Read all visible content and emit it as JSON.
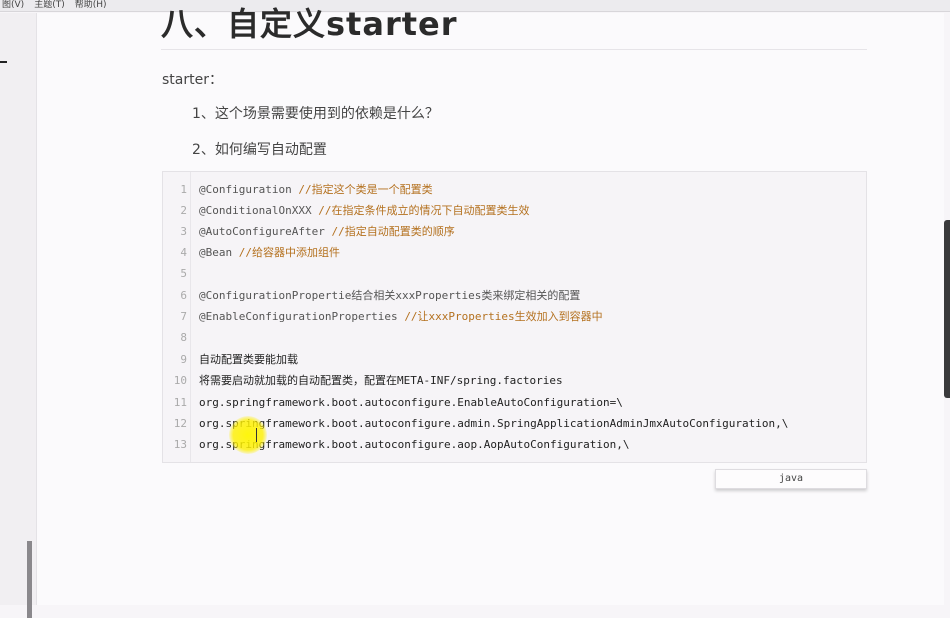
{
  "menu": {
    "view": "图(V)",
    "theme": "主题(T)",
    "help": "帮助(H)"
  },
  "doc": {
    "title": "八、自定义starter",
    "starter_label": "starter：",
    "questions": [
      "1、这个场景需要使用到的依赖是什么？",
      "2、如何编写自动配置"
    ]
  },
  "code": {
    "language": "java",
    "lines": [
      {
        "num": "1",
        "code": "@Configuration  ",
        "comment": "//指定这个类是一个配置类"
      },
      {
        "num": "2",
        "code": "@ConditionalOnXXX  ",
        "comment": "//在指定条件成立的情况下自动配置类生效"
      },
      {
        "num": "3",
        "code": "@AutoConfigureAfter  ",
        "comment": "//指定自动配置类的顺序"
      },
      {
        "num": "4",
        "code": "@Bean  ",
        "comment": "//给容器中添加组件"
      },
      {
        "num": "5",
        "code": "",
        "comment": ""
      },
      {
        "num": "6",
        "code": "@ConfigurationPropertie结合相关xxxProperties类来绑定相关的配置",
        "comment": ""
      },
      {
        "num": "7",
        "code": "@EnableConfigurationProperties ",
        "comment": "//让xxxProperties生效加入到容器中"
      },
      {
        "num": "8",
        "code": "",
        "comment": ""
      },
      {
        "num": "9",
        "code": "自动配置类要能加载",
        "comment": ""
      },
      {
        "num": "10",
        "code": "将需要启动就加载的自动配置类，配置在META-INF/spring.factories",
        "comment": ""
      },
      {
        "num": "11",
        "code": "org.springframework.boot.autoconfigure.EnableAutoConfiguration=\\",
        "comment": ""
      },
      {
        "num": "12",
        "code": "org.springframework.boot.autoconfigure.admin.SpringApplicationAdminJmxAutoConfiguration,\\",
        "comment": ""
      },
      {
        "num": "13",
        "code": "org.springframework.boot.autoconfigure.aop.AopAutoConfiguration,\\",
        "comment": ""
      }
    ]
  }
}
